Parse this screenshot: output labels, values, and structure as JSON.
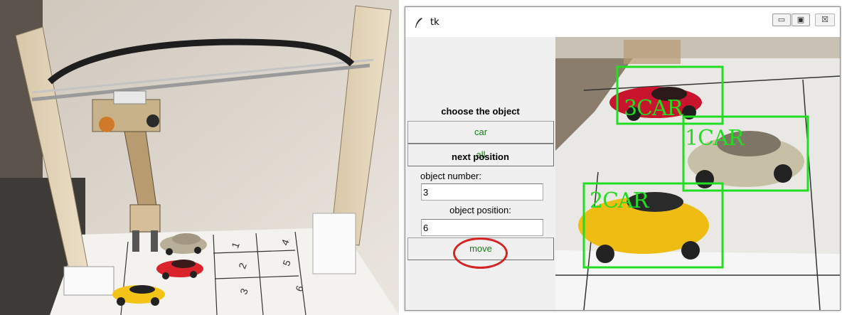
{
  "window": {
    "title": "tk",
    "controls": {
      "minimize": "▭",
      "maximize": "▣",
      "close": "☒"
    }
  },
  "panel": {
    "choose_label": "choose the object",
    "car_button": "car",
    "all_button": "all",
    "next_position_label": "next position",
    "object_number_label": "object number:",
    "object_number_value": "3",
    "object_position_label": "object position:",
    "object_position_value": "6",
    "move_button": "move"
  },
  "photo": {
    "grid_numbers": [
      "1",
      "4",
      "2",
      "5",
      "3",
      "6"
    ]
  },
  "detections": [
    {
      "label": "3CAR"
    },
    {
      "label": "1CAR"
    },
    {
      "label": "2CAR"
    }
  ],
  "colors": {
    "detection_box": "#22dd22",
    "button_text": "#1a7a1a",
    "highlight_ring": "#d42424"
  }
}
